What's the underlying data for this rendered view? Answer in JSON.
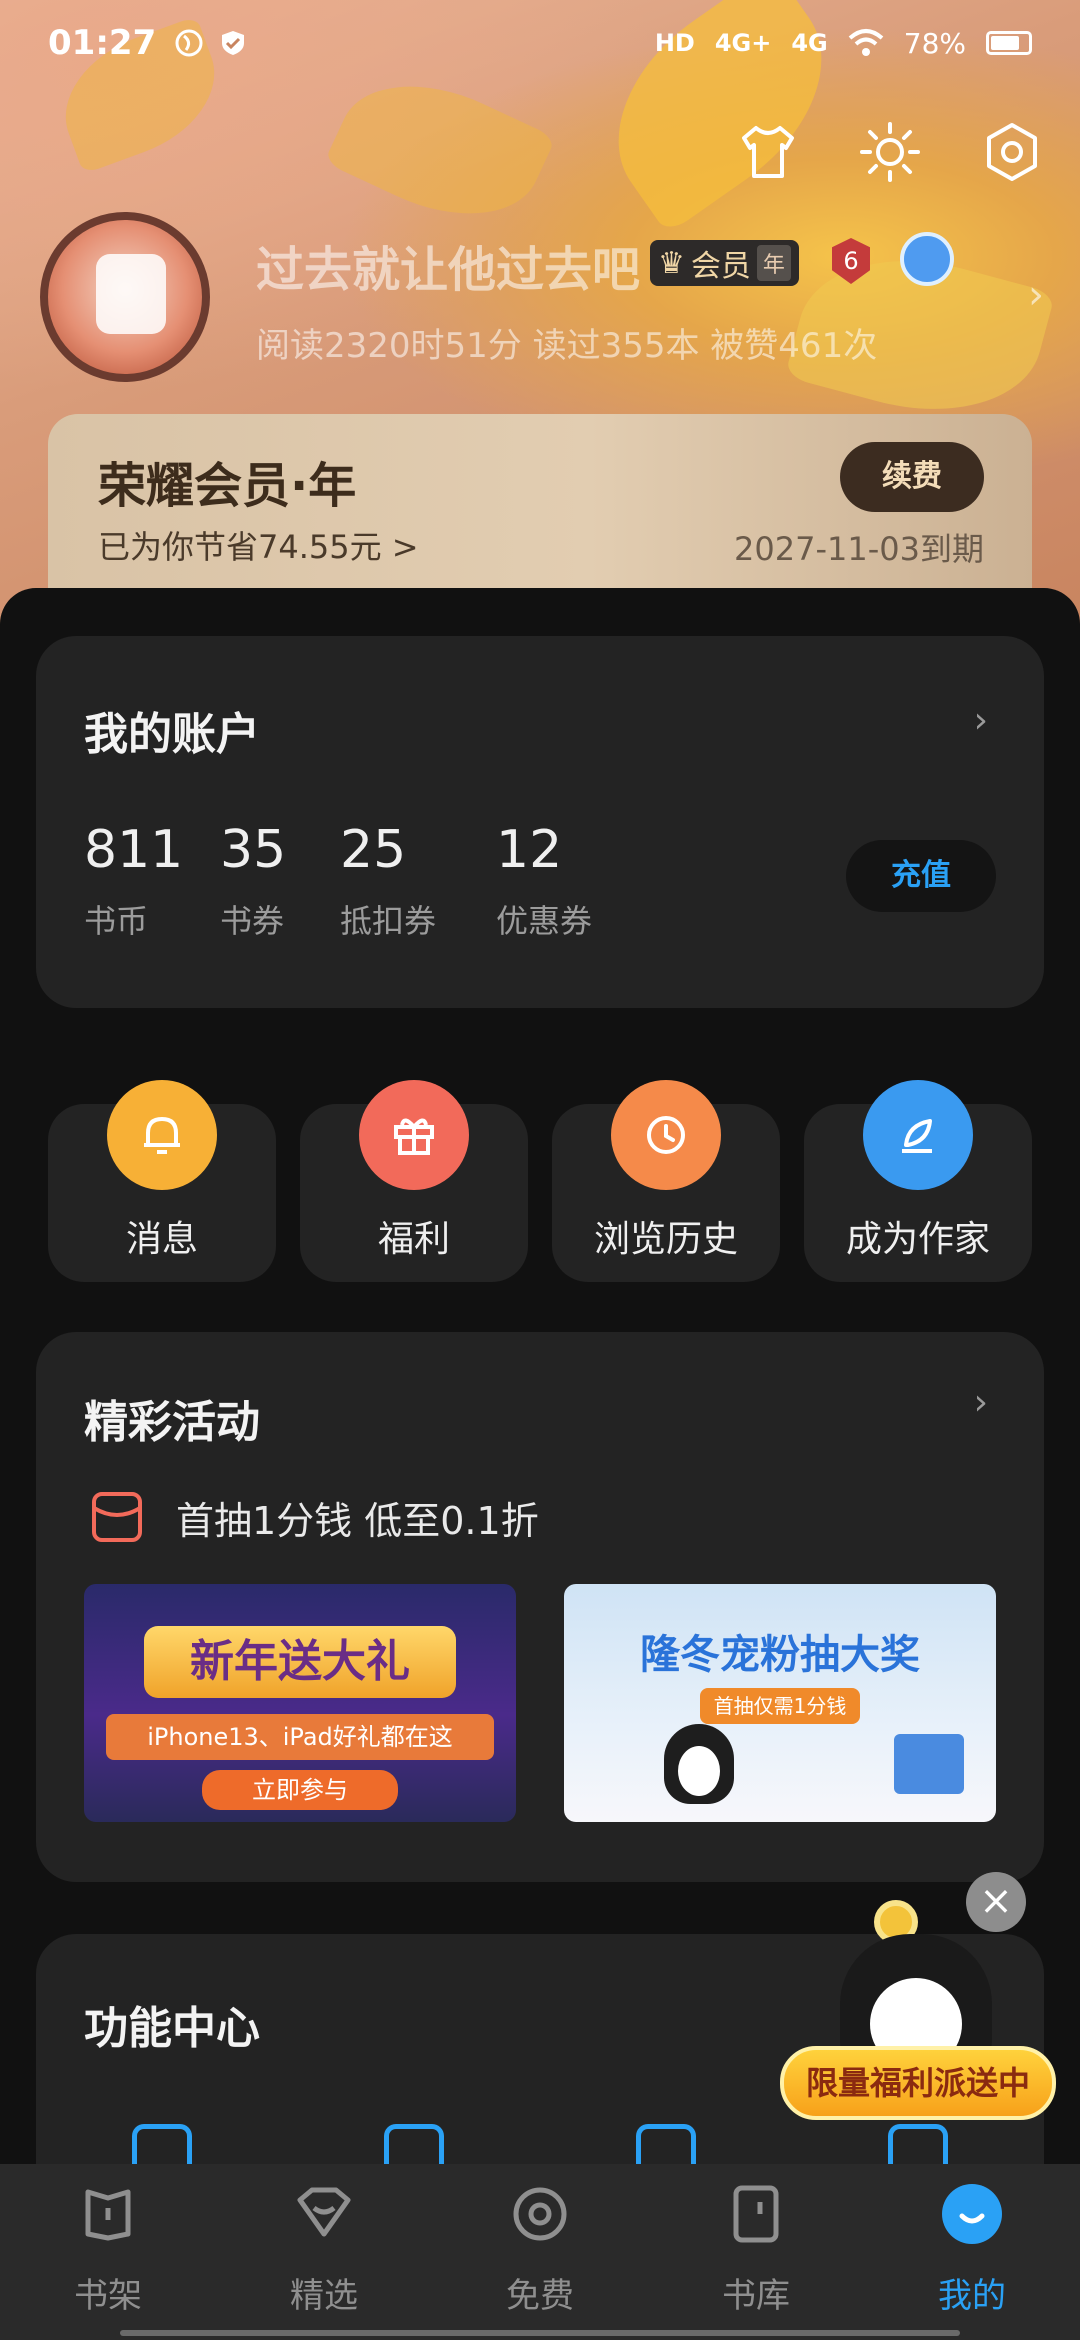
{
  "status_bar": {
    "time": "01:27",
    "network": [
      "4G+",
      "4G"
    ],
    "hd_label": "HD",
    "battery": "78%"
  },
  "header_icons": [
    "tshirt-icon",
    "sun-icon",
    "settings-icon"
  ],
  "profile": {
    "username": "过去就让他过去吧",
    "vip_label": "会员",
    "vip_term": "年",
    "level": "6",
    "stats": "阅读2320时51分  读过355本  被赞461次"
  },
  "membership": {
    "title": "荣耀会员·年",
    "savings": "已为你节省74.55元 >",
    "renew_label": "续费",
    "expire": "2027-11-03到期"
  },
  "account": {
    "title": "我的账户",
    "items": [
      {
        "value": "811",
        "label": "书币"
      },
      {
        "value": "35",
        "label": "书券"
      },
      {
        "value": "25",
        "label": "抵扣券"
      },
      {
        "value": "12",
        "label": "优惠券"
      }
    ],
    "recharge_label": "充值"
  },
  "quick_tiles": [
    {
      "label": "消息",
      "icon": "bell-icon",
      "color": "#f7b036"
    },
    {
      "label": "福利",
      "icon": "gift-icon",
      "color": "#f26a5a"
    },
    {
      "label": "浏览历史",
      "icon": "clock-icon",
      "color": "#f58a4a"
    },
    {
      "label": "成为作家",
      "icon": "pen-icon",
      "color": "#3a9af0"
    }
  ],
  "activities": {
    "title": "精彩活动",
    "promo_text": "首抽1分钱 低至0.1折",
    "banners": [
      {
        "title": "新年送大礼",
        "subtitle": "iPhone13、iPad好礼都在这",
        "button": "立即参与"
      },
      {
        "title": "隆冬宠粉抽大奖",
        "subtitle": "首抽仅需1分钱"
      }
    ]
  },
  "function_center": {
    "title": "功能中心"
  },
  "floating_promo": {
    "close": "×",
    "label": "限量福利派送中"
  },
  "bottom_nav": [
    {
      "label": "书架",
      "icon": "bookshelf-icon",
      "active": false
    },
    {
      "label": "精选",
      "icon": "heart-chat-icon",
      "active": false
    },
    {
      "label": "免费",
      "icon": "target-icon",
      "active": false
    },
    {
      "label": "书库",
      "icon": "book-icon",
      "active": false
    },
    {
      "label": "我的",
      "icon": "profile-icon",
      "active": true
    }
  ],
  "colors": {
    "accent": "#2aa1f5",
    "card_bg": "#232323",
    "page_bg": "#111111"
  }
}
